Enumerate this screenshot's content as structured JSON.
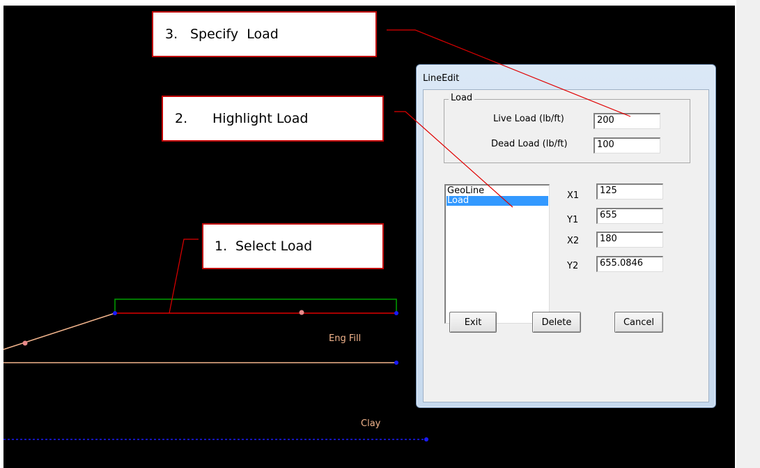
{
  "canvas": {
    "labels": {
      "eng_fill": "Eng Fill",
      "clay": "Clay"
    }
  },
  "callouts": [
    {
      "number": "3.",
      "text": "Specify  Load"
    },
    {
      "number": "2.",
      "text": "Highlight Load"
    },
    {
      "number": "1.",
      "text": "Select Load"
    }
  ],
  "dialog": {
    "title": "LineEdit",
    "load_group": {
      "legend": "Load",
      "live_load_label": "Live Load (lb/ft)",
      "live_load_value": "200",
      "dead_load_label": "Dead Load (lb/ft)",
      "dead_load_value": "100"
    },
    "list_items": [
      "GeoLine",
      "Load"
    ],
    "selected_index": 1,
    "coords": {
      "x1_label": "X1",
      "x1_value": "125",
      "y1_label": "Y1",
      "y1_value": "655",
      "x2_label": "X2",
      "x2_value": "180",
      "y2_label": "Y2",
      "y2_value": "655.0846"
    },
    "buttons": {
      "exit": "Exit",
      "delete": "Delete",
      "cancel": "Cancel"
    }
  },
  "colors": {
    "canvas_bg": "#000000",
    "load_line": "#e00000",
    "load_box": "#00a000",
    "fill_line": "#f2b48c",
    "clay_line": "#0000ff",
    "leader_line": "#e00000",
    "selection": "#3399ff"
  }
}
